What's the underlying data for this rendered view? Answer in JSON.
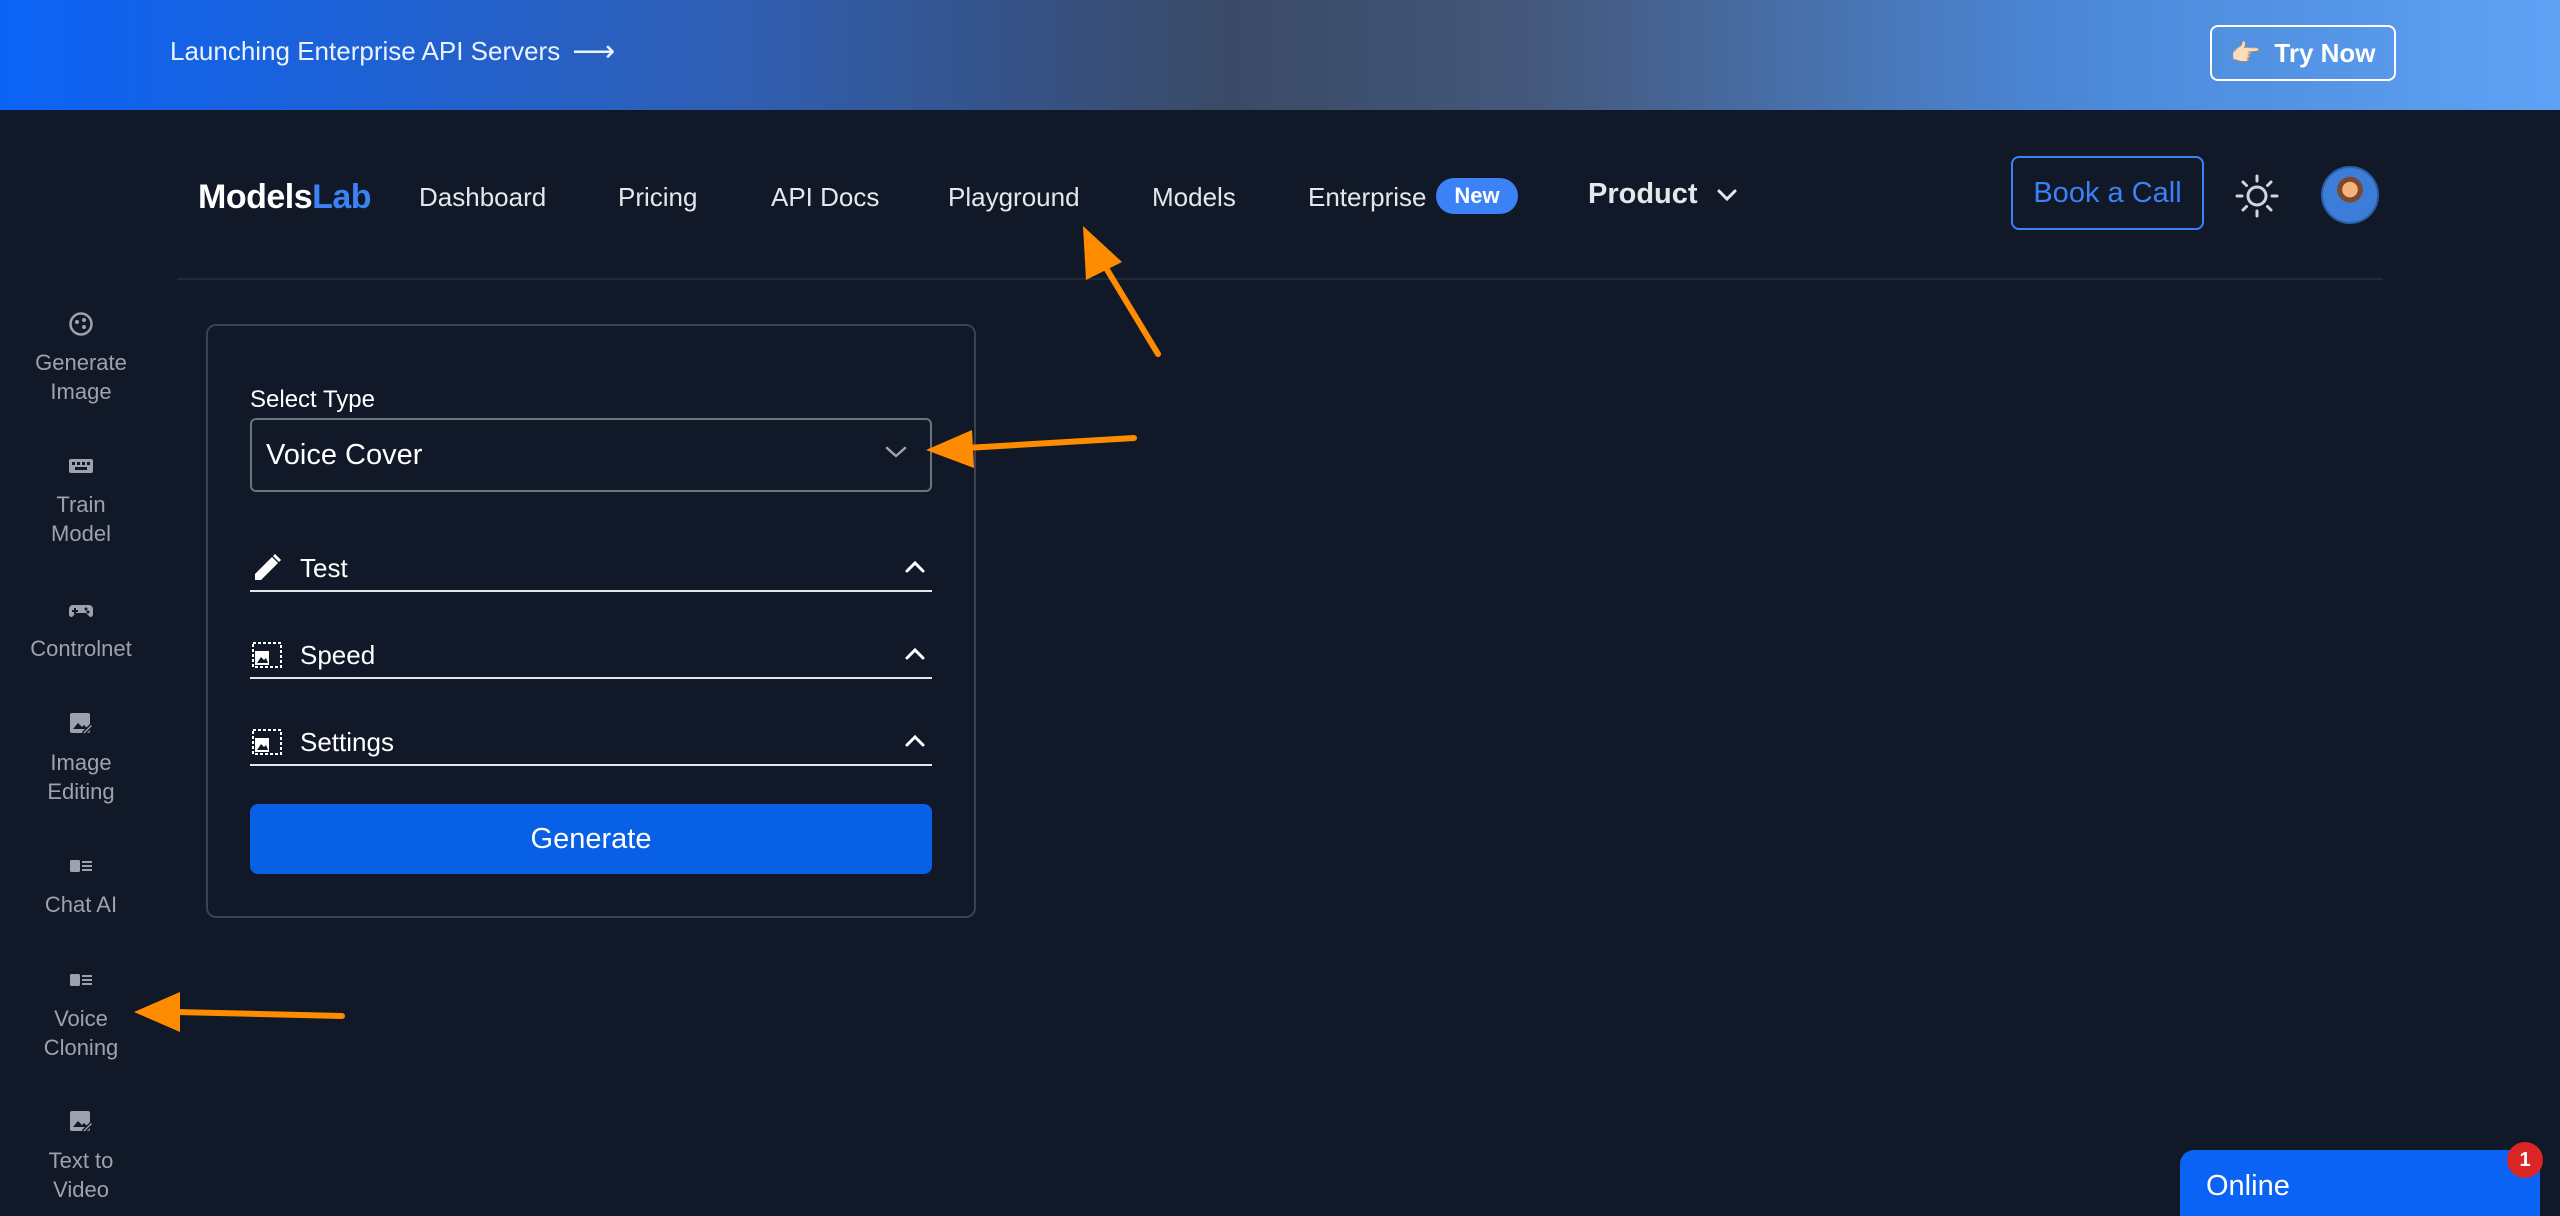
{
  "banner": {
    "text": "Launching Enterprise API Servers",
    "arrow": "⟶",
    "cta_label": "Try Now",
    "cta_icon": "👉🏻"
  },
  "nav": {
    "logo_models": "Models",
    "logo_lab": "Lab",
    "links": [
      "Dashboard",
      "Pricing",
      "API Docs",
      "Playground",
      "Models",
      "Enterprise"
    ],
    "new_badge": "New",
    "product_label": "Product",
    "book_call_label": "Book a Call",
    "theme_icon": "sun-icon",
    "avatar_icon": "user-avatar"
  },
  "sidebar": {
    "items": [
      {
        "label1": "Generate",
        "label2": "Image",
        "icon": "palette-icon"
      },
      {
        "label1": "Train",
        "label2": "Model",
        "icon": "keyboard-icon"
      },
      {
        "label1": "Controlnet",
        "label2": "",
        "icon": "gamepad-icon"
      },
      {
        "label1": "Image",
        "label2": "Editing",
        "icon": "edit-image-icon"
      },
      {
        "label1": "Chat AI",
        "label2": "",
        "icon": "chat-card-icon"
      },
      {
        "label1": "Voice",
        "label2": "Cloning",
        "icon": "voice-card-icon"
      },
      {
        "label1": "Text to",
        "label2": "Video",
        "icon": "video-edit-icon"
      }
    ]
  },
  "form": {
    "select_label": "Select Type",
    "select_value": "Voice Cover",
    "sections": [
      {
        "label": "Test",
        "icon": "pencil-icon"
      },
      {
        "label": "Speed",
        "icon": "image-icon"
      },
      {
        "label": "Settings",
        "icon": "image-icon"
      }
    ],
    "generate_label": "Generate"
  },
  "chat_widget": {
    "label": "Online",
    "badge": "1"
  },
  "colors": {
    "accent": "#3b82f6",
    "button": "#0760e6",
    "background": "#111827",
    "annotation": "#ff8c00"
  }
}
